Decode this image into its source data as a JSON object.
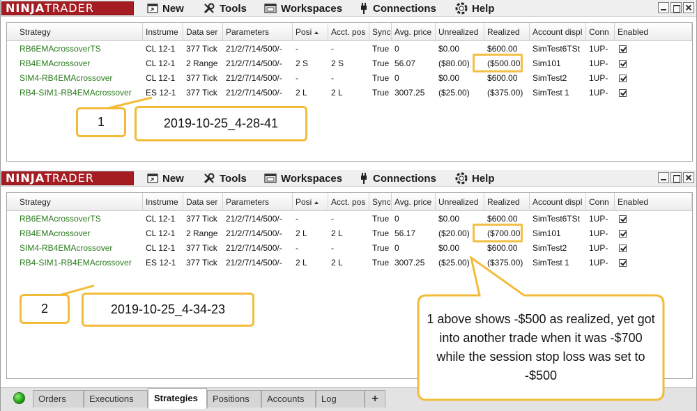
{
  "app": {
    "logo_part1": "NINJA",
    "logo_part2": "TRADER",
    "menu": [
      {
        "label": "New",
        "icon": "new-window-icon"
      },
      {
        "label": "Tools",
        "icon": "tools-icon"
      },
      {
        "label": "Workspaces",
        "icon": "workspaces-icon"
      },
      {
        "label": "Connections",
        "icon": "plug-icon"
      },
      {
        "label": "Help",
        "icon": "help-icon"
      }
    ]
  },
  "columns": [
    "Strategy",
    "Instrume",
    "Data ser",
    "Parameters",
    "Posi",
    "Acct. pos",
    "Sync",
    "Avg. price",
    "Unrealized",
    "Realized",
    "Account displ",
    "Conn",
    "Enabled"
  ],
  "panel1": {
    "rows": [
      [
        "RB6EMAcrossoverTS",
        "CL 12-1",
        "377 Tick",
        "21/2/7/14/500/-",
        "-",
        "-",
        "True",
        "0",
        "$0.00",
        "$600.00",
        "SimTest6TSt",
        "1UP-",
        true
      ],
      [
        "RB4EMAcrossover",
        "CL 12-1",
        "2 Range",
        "21/2/7/14/500/-",
        "2 S",
        "2 S",
        "True",
        "56.07",
        "($80.00)",
        "($500.00)",
        "Sim101",
        "1UP-",
        true
      ],
      [
        "SIM4-RB4EMAcrossover",
        "CL 12-1",
        "377 Tick",
        "21/2/7/14/500/-",
        "-",
        "-",
        "True",
        "0",
        "$0.00",
        "$600.00",
        "SimTest2",
        "1UP-",
        true
      ],
      [
        "RB4-SIM1-RB4EMAcrossover",
        "ES 12-1",
        "377 Tick",
        "21/2/7/14/500/-",
        "2 L",
        "2 L",
        "True",
        "3007.25",
        "($25.00)",
        "($375.00)",
        "SimTest 1",
        "1UP-",
        true
      ]
    ],
    "callout_number": "1",
    "callout_timestamp": "2019-10-25_4-28-41"
  },
  "panel2": {
    "rows": [
      [
        "RB6EMAcrossoverTS",
        "CL 12-1",
        "377 Tick",
        "21/2/7/14/500/-",
        "-",
        "-",
        "True",
        "0",
        "$0.00",
        "$600.00",
        "SimTest6TSt",
        "1UP-",
        true
      ],
      [
        "RB4EMAcrossover",
        "CL 12-1",
        "2 Range",
        "21/2/7/14/500/-",
        "2 L",
        "2 L",
        "True",
        "56.17",
        "($20.00)",
        "($700.00)",
        "Sim101",
        "1UP-",
        true
      ],
      [
        "SIM4-RB4EMAcrossover",
        "CL 12-1",
        "377 Tick",
        "21/2/7/14/500/-",
        "-",
        "-",
        "True",
        "0",
        "$0.00",
        "$600.00",
        "SimTest2",
        "1UP-",
        true
      ],
      [
        "RB4-SIM1-RB4EMAcrossover",
        "ES 12-1",
        "377 Tick",
        "21/2/7/14/500/-",
        "2 L",
        "2 L",
        "True",
        "3007.25",
        "($25.00)",
        "($375.00)",
        "SimTest 1",
        "1UP-",
        true
      ]
    ],
    "callout_number": "2",
    "callout_timestamp": "2019-10-25_4-34-23"
  },
  "note": "1 above shows -$500 as realized, yet got into another trade when it was -$700 while the session stop loss was set to -$500",
  "tabs": [
    "Orders",
    "Executions",
    "Strategies",
    "Positions",
    "Accounts",
    "Log",
    "+"
  ],
  "active_tab": "Strategies",
  "colors": {
    "logo_bg": "#a51d22",
    "strategy_text": "#2a7a1d",
    "callout_border": "#f2bc3a",
    "status_green": "#1d9e12"
  }
}
